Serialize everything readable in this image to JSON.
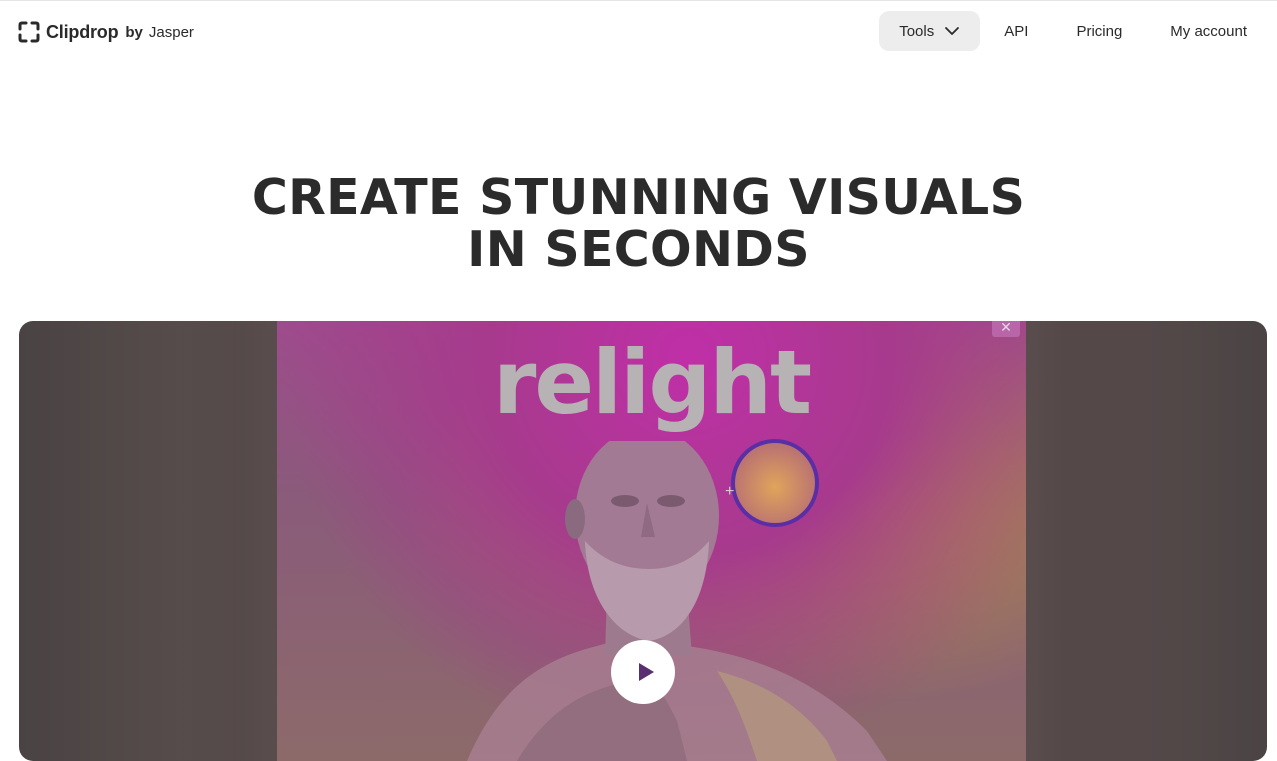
{
  "header": {
    "brand_name": "Clipdrop",
    "brand_by": "by",
    "brand_jasper": "Jasper",
    "nav": {
      "tools_label": "Tools",
      "api_label": "API",
      "pricing_label": "Pricing",
      "account_label": "My account"
    }
  },
  "hero": {
    "title_line1": "CREATE STUNNING VISUALS",
    "title_line2": "IN SECONDS"
  },
  "video": {
    "overlay_word": "relight",
    "close_symbol": "✕",
    "crosshair_symbol": "+",
    "play_icon": "play-icon"
  },
  "colors": {
    "nav_active_bg": "#ededed",
    "title_text": "#2b2b2b",
    "video_accent_magenta": "#c02fa8",
    "light_ring": "#5a2fa6"
  }
}
